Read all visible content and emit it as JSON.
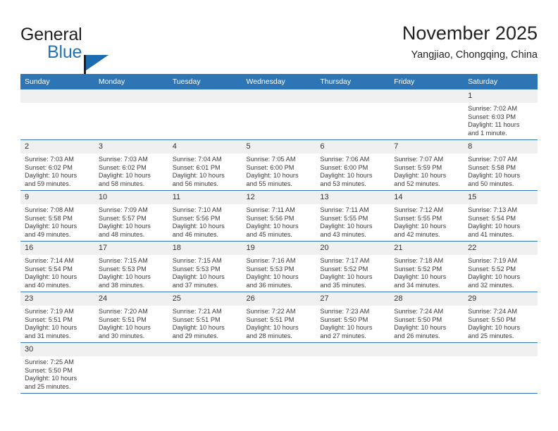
{
  "brand": {
    "name_part1": "General",
    "name_part2": "Blue",
    "logo_icon": "blue-triangle-logo"
  },
  "header": {
    "month_title": "November 2025",
    "location": "Yangjiao, Chongqing, China"
  },
  "colors": {
    "header_blue": "#2e75b6",
    "brand_blue": "#2272b8",
    "daynum_band": "#f0f0f0",
    "text": "#3b3b3b"
  },
  "calendar": {
    "weekday_headers": [
      "Sunday",
      "Monday",
      "Tuesday",
      "Wednesday",
      "Thursday",
      "Friday",
      "Saturday"
    ],
    "weeks": [
      [
        {
          "day": "",
          "sunrise": "",
          "sunset": "",
          "daylight": "",
          "daylight2": ""
        },
        {
          "day": "",
          "sunrise": "",
          "sunset": "",
          "daylight": "",
          "daylight2": ""
        },
        {
          "day": "",
          "sunrise": "",
          "sunset": "",
          "daylight": "",
          "daylight2": ""
        },
        {
          "day": "",
          "sunrise": "",
          "sunset": "",
          "daylight": "",
          "daylight2": ""
        },
        {
          "day": "",
          "sunrise": "",
          "sunset": "",
          "daylight": "",
          "daylight2": ""
        },
        {
          "day": "",
          "sunrise": "",
          "sunset": "",
          "daylight": "",
          "daylight2": ""
        },
        {
          "day": "1",
          "sunrise": "Sunrise: 7:02 AM",
          "sunset": "Sunset: 6:03 PM",
          "daylight": "Daylight: 11 hours",
          "daylight2": "and 1 minute."
        }
      ],
      [
        {
          "day": "2",
          "sunrise": "Sunrise: 7:03 AM",
          "sunset": "Sunset: 6:02 PM",
          "daylight": "Daylight: 10 hours",
          "daylight2": "and 59 minutes."
        },
        {
          "day": "3",
          "sunrise": "Sunrise: 7:03 AM",
          "sunset": "Sunset: 6:02 PM",
          "daylight": "Daylight: 10 hours",
          "daylight2": "and 58 minutes."
        },
        {
          "day": "4",
          "sunrise": "Sunrise: 7:04 AM",
          "sunset": "Sunset: 6:01 PM",
          "daylight": "Daylight: 10 hours",
          "daylight2": "and 56 minutes."
        },
        {
          "day": "5",
          "sunrise": "Sunrise: 7:05 AM",
          "sunset": "Sunset: 6:00 PM",
          "daylight": "Daylight: 10 hours",
          "daylight2": "and 55 minutes."
        },
        {
          "day": "6",
          "sunrise": "Sunrise: 7:06 AM",
          "sunset": "Sunset: 6:00 PM",
          "daylight": "Daylight: 10 hours",
          "daylight2": "and 53 minutes."
        },
        {
          "day": "7",
          "sunrise": "Sunrise: 7:07 AM",
          "sunset": "Sunset: 5:59 PM",
          "daylight": "Daylight: 10 hours",
          "daylight2": "and 52 minutes."
        },
        {
          "day": "8",
          "sunrise": "Sunrise: 7:07 AM",
          "sunset": "Sunset: 5:58 PM",
          "daylight": "Daylight: 10 hours",
          "daylight2": "and 50 minutes."
        }
      ],
      [
        {
          "day": "9",
          "sunrise": "Sunrise: 7:08 AM",
          "sunset": "Sunset: 5:58 PM",
          "daylight": "Daylight: 10 hours",
          "daylight2": "and 49 minutes."
        },
        {
          "day": "10",
          "sunrise": "Sunrise: 7:09 AM",
          "sunset": "Sunset: 5:57 PM",
          "daylight": "Daylight: 10 hours",
          "daylight2": "and 48 minutes."
        },
        {
          "day": "11",
          "sunrise": "Sunrise: 7:10 AM",
          "sunset": "Sunset: 5:56 PM",
          "daylight": "Daylight: 10 hours",
          "daylight2": "and 46 minutes."
        },
        {
          "day": "12",
          "sunrise": "Sunrise: 7:11 AM",
          "sunset": "Sunset: 5:56 PM",
          "daylight": "Daylight: 10 hours",
          "daylight2": "and 45 minutes."
        },
        {
          "day": "13",
          "sunrise": "Sunrise: 7:11 AM",
          "sunset": "Sunset: 5:55 PM",
          "daylight": "Daylight: 10 hours",
          "daylight2": "and 43 minutes."
        },
        {
          "day": "14",
          "sunrise": "Sunrise: 7:12 AM",
          "sunset": "Sunset: 5:55 PM",
          "daylight": "Daylight: 10 hours",
          "daylight2": "and 42 minutes."
        },
        {
          "day": "15",
          "sunrise": "Sunrise: 7:13 AM",
          "sunset": "Sunset: 5:54 PM",
          "daylight": "Daylight: 10 hours",
          "daylight2": "and 41 minutes."
        }
      ],
      [
        {
          "day": "16",
          "sunrise": "Sunrise: 7:14 AM",
          "sunset": "Sunset: 5:54 PM",
          "daylight": "Daylight: 10 hours",
          "daylight2": "and 40 minutes."
        },
        {
          "day": "17",
          "sunrise": "Sunrise: 7:15 AM",
          "sunset": "Sunset: 5:53 PM",
          "daylight": "Daylight: 10 hours",
          "daylight2": "and 38 minutes."
        },
        {
          "day": "18",
          "sunrise": "Sunrise: 7:15 AM",
          "sunset": "Sunset: 5:53 PM",
          "daylight": "Daylight: 10 hours",
          "daylight2": "and 37 minutes."
        },
        {
          "day": "19",
          "sunrise": "Sunrise: 7:16 AM",
          "sunset": "Sunset: 5:53 PM",
          "daylight": "Daylight: 10 hours",
          "daylight2": "and 36 minutes."
        },
        {
          "day": "20",
          "sunrise": "Sunrise: 7:17 AM",
          "sunset": "Sunset: 5:52 PM",
          "daylight": "Daylight: 10 hours",
          "daylight2": "and 35 minutes."
        },
        {
          "day": "21",
          "sunrise": "Sunrise: 7:18 AM",
          "sunset": "Sunset: 5:52 PM",
          "daylight": "Daylight: 10 hours",
          "daylight2": "and 34 minutes."
        },
        {
          "day": "22",
          "sunrise": "Sunrise: 7:19 AM",
          "sunset": "Sunset: 5:52 PM",
          "daylight": "Daylight: 10 hours",
          "daylight2": "and 32 minutes."
        }
      ],
      [
        {
          "day": "23",
          "sunrise": "Sunrise: 7:19 AM",
          "sunset": "Sunset: 5:51 PM",
          "daylight": "Daylight: 10 hours",
          "daylight2": "and 31 minutes."
        },
        {
          "day": "24",
          "sunrise": "Sunrise: 7:20 AM",
          "sunset": "Sunset: 5:51 PM",
          "daylight": "Daylight: 10 hours",
          "daylight2": "and 30 minutes."
        },
        {
          "day": "25",
          "sunrise": "Sunrise: 7:21 AM",
          "sunset": "Sunset: 5:51 PM",
          "daylight": "Daylight: 10 hours",
          "daylight2": "and 29 minutes."
        },
        {
          "day": "26",
          "sunrise": "Sunrise: 7:22 AM",
          "sunset": "Sunset: 5:51 PM",
          "daylight": "Daylight: 10 hours",
          "daylight2": "and 28 minutes."
        },
        {
          "day": "27",
          "sunrise": "Sunrise: 7:23 AM",
          "sunset": "Sunset: 5:50 PM",
          "daylight": "Daylight: 10 hours",
          "daylight2": "and 27 minutes."
        },
        {
          "day": "28",
          "sunrise": "Sunrise: 7:24 AM",
          "sunset": "Sunset: 5:50 PM",
          "daylight": "Daylight: 10 hours",
          "daylight2": "and 26 minutes."
        },
        {
          "day": "29",
          "sunrise": "Sunrise: 7:24 AM",
          "sunset": "Sunset: 5:50 PM",
          "daylight": "Daylight: 10 hours",
          "daylight2": "and 25 minutes."
        }
      ],
      [
        {
          "day": "30",
          "sunrise": "Sunrise: 7:25 AM",
          "sunset": "Sunset: 5:50 PM",
          "daylight": "Daylight: 10 hours",
          "daylight2": "and 25 minutes."
        },
        {
          "day": "",
          "sunrise": "",
          "sunset": "",
          "daylight": "",
          "daylight2": ""
        },
        {
          "day": "",
          "sunrise": "",
          "sunset": "",
          "daylight": "",
          "daylight2": ""
        },
        {
          "day": "",
          "sunrise": "",
          "sunset": "",
          "daylight": "",
          "daylight2": ""
        },
        {
          "day": "",
          "sunrise": "",
          "sunset": "",
          "daylight": "",
          "daylight2": ""
        },
        {
          "day": "",
          "sunrise": "",
          "sunset": "",
          "daylight": "",
          "daylight2": ""
        },
        {
          "day": "",
          "sunrise": "",
          "sunset": "",
          "daylight": "",
          "daylight2": ""
        }
      ]
    ]
  }
}
